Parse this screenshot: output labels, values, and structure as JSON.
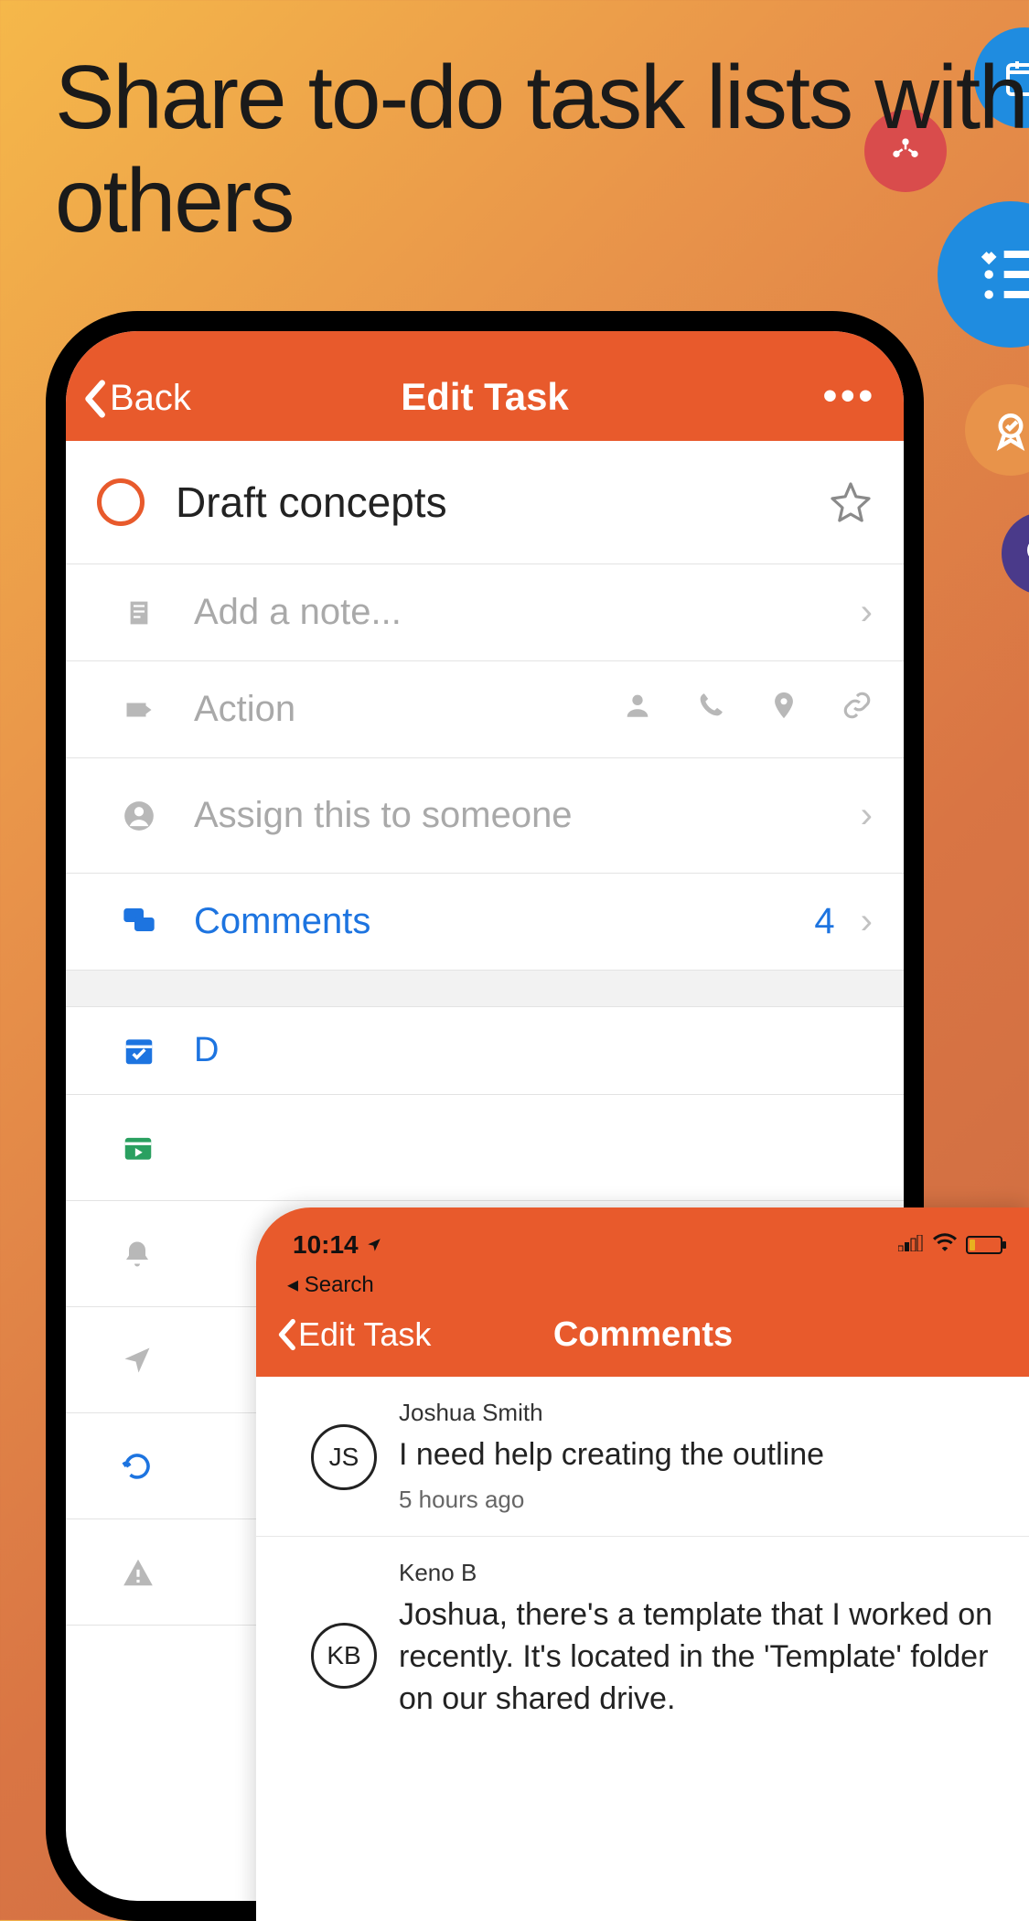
{
  "promo": {
    "headline": "Share to-do task lists with others"
  },
  "phone1": {
    "nav": {
      "back": "Back",
      "title": "Edit Task",
      "more": "•••"
    },
    "task_title": "Draft concepts",
    "rows": {
      "note_placeholder": "Add a note...",
      "action_label": "Action",
      "assign_label": "Assign this to someone",
      "comments_label": "Comments",
      "comments_count": "4"
    },
    "partial_label": "D"
  },
  "phone2": {
    "status": {
      "time": "10:14",
      "crumb": "◂ Search"
    },
    "nav": {
      "back": "Edit Task",
      "title": "Comments"
    },
    "comments": [
      {
        "initials": "JS",
        "author": "Joshua Smith",
        "text": "I need help creating the outline",
        "time": "5 hours ago"
      },
      {
        "initials": "KB",
        "author": "Keno B",
        "text": "Joshua, there's a template that I worked on recently. It's located in the 'Template' folder on our shared drive."
      }
    ]
  }
}
